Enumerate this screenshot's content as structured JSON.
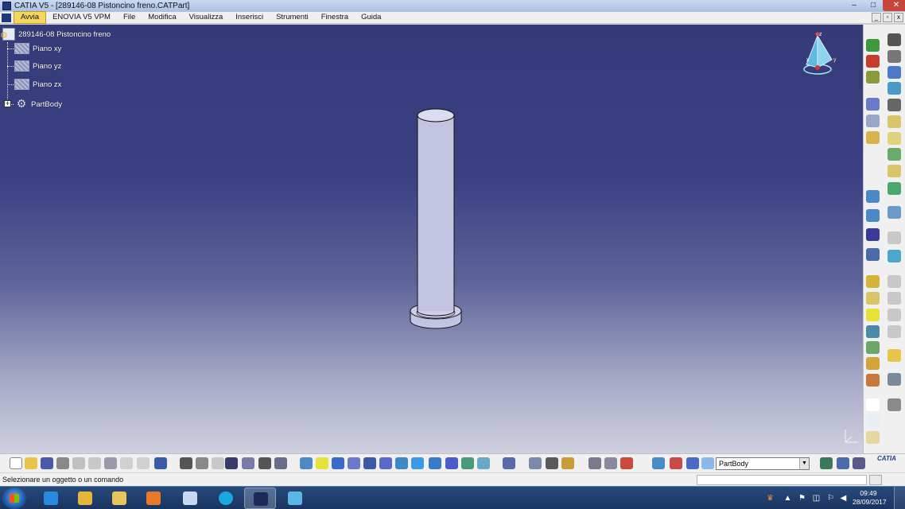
{
  "window": {
    "title": "CATIA V5 - [289146-08 Pistoncino freno.CATPart]",
    "controls": {
      "minimize": "–",
      "maximize": "□",
      "close": "✕"
    }
  },
  "menubar": {
    "items": [
      "Avvia",
      "ENOVIA V5 VPM",
      "File",
      "Modifica",
      "Visualizza",
      "Inserisci",
      "Strumenti",
      "Finestra",
      "Guida"
    ],
    "active": "Avvia",
    "doc_controls": [
      "_",
      "▫",
      "x"
    ]
  },
  "tree": {
    "root": "289146-08 Pistoncino freno",
    "children": [
      "Piano xy",
      "Piano yz",
      "Piano zx",
      "PartBody"
    ],
    "expander": "+"
  },
  "compass": {
    "axis_x": "x",
    "axis_y": "y",
    "axis_z": "z"
  },
  "toolbar_bottom": {
    "current_body": "PartBody",
    "dropdown_arrow": "▼",
    "brand": "CATIA",
    "icons": [
      "new-icon",
      "open-icon",
      "save-icon",
      "print-icon",
      "cut-icon",
      "copy-icon",
      "paste-icon",
      "undo-icon",
      "redo-icon",
      "whats-this-icon",
      "formula-icon",
      "comment-icon",
      "knowledge-icon",
      "table-icon",
      "graph-tree-icon",
      "measure-icon",
      "fly-icon",
      "fit-all-icon",
      "pan-icon",
      "rotate-icon",
      "zoom-in-icon",
      "zoom-out-icon",
      "normal-view-icon",
      "multi-view-icon",
      "iso-view-icon",
      "shading-icon",
      "hide-show-icon",
      "swap-view-icon",
      "update-icon",
      "scan-icon",
      "axis-icon",
      "sketch-icon",
      "view-mode-icon",
      "measure-between-icon",
      "measure-item-icon",
      "thermal-icon",
      "body-icon",
      "apply-material-icon",
      "analysis-icon",
      "spotlight-icon"
    ]
  },
  "status": {
    "message": "Selezionare un oggetto o un comando"
  },
  "taskbar": {
    "apps": [
      "internet-explorer-icon",
      "outlook-icon",
      "file-explorer-icon",
      "media-player-icon",
      "airplane-app-icon",
      "skype-icon",
      "catia-app-icon",
      "star-app-icon"
    ],
    "active": "catia-app-icon",
    "time": "09:49",
    "date": "28/09/2017"
  },
  "colors": {
    "viewport_top": "#353a79",
    "viewport_bottom": "#cfd0e0",
    "part_fill": "#c3c4e2",
    "accent": "#f6d65c"
  }
}
